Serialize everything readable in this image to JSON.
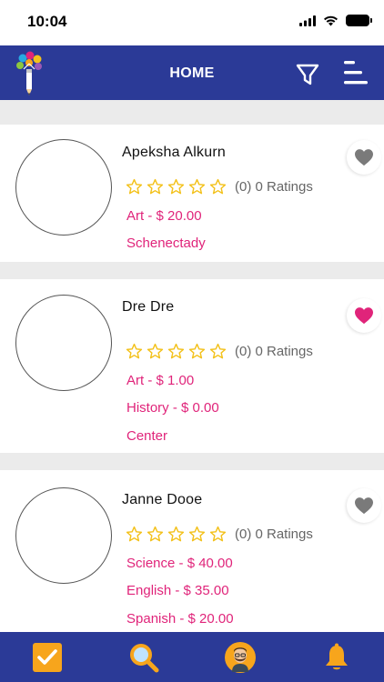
{
  "status_bar": {
    "time": "10:04"
  },
  "header": {
    "title": "HOME"
  },
  "tutors": [
    {
      "name": "Apeksha Alkurn",
      "rating_text": "(0) 0 Ratings",
      "lines": [
        "Art - $ 20.00",
        "Schenectady"
      ],
      "favorite": false
    },
    {
      "name": "Dre Dre",
      "rating_text": "(0) 0 Ratings",
      "lines": [
        "Art - $ 1.00",
        "History - $ 0.00",
        "Center"
      ],
      "favorite": true
    },
    {
      "name": "Janne Dooe",
      "rating_text": "(0) 0 Ratings",
      "lines": [
        "Science - $ 40.00",
        "English - $ 35.00",
        "Spanish - $ 20.00"
      ],
      "favorite": false
    }
  ],
  "bottom_nav": {
    "items": [
      "checkbox-icon",
      "search-icon",
      "profile-avatar-icon",
      "bell-icon"
    ]
  },
  "colors": {
    "brand": "#2b3a97",
    "accent_pink": "#e0247a",
    "star_yellow": "#f3c11b",
    "nav_orange": "#f7a51c"
  }
}
